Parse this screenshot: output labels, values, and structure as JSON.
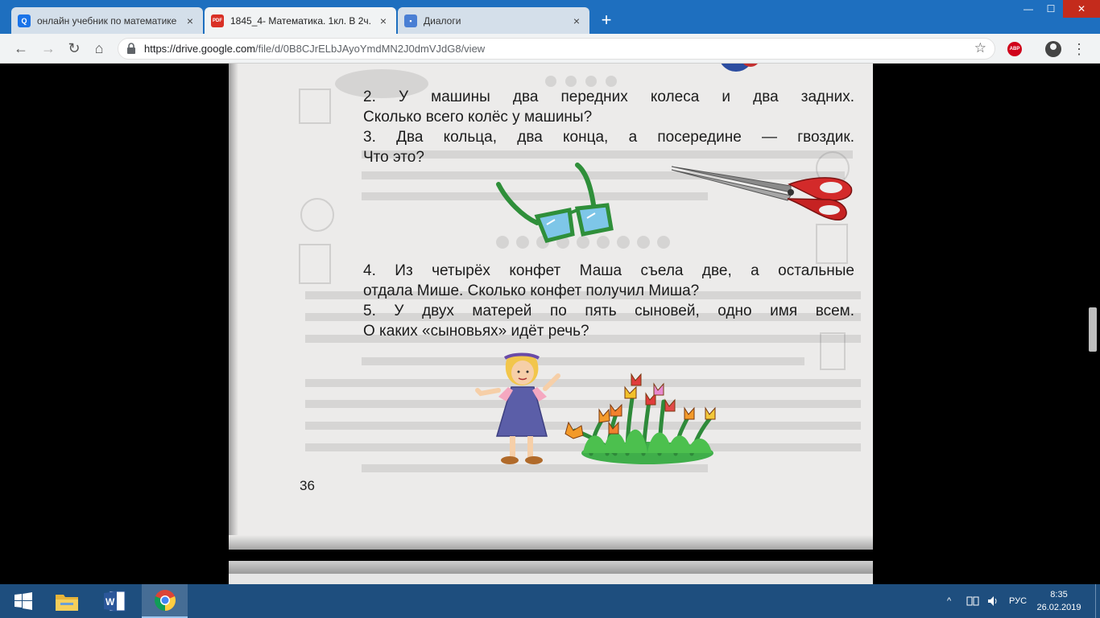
{
  "browser": {
    "tabs": [
      {
        "title": "онлайн учебник по математике",
        "icon": "search-icon",
        "active": false
      },
      {
        "title": "1845_4- Математика. 1кл. В 2ч.",
        "icon": "pdf-icon",
        "icon_text": "PDF",
        "active": true
      },
      {
        "title": "Диалоги",
        "icon": "chat-icon",
        "active": false
      }
    ],
    "close_glyph": "×",
    "new_tab_glyph": "+",
    "window_buttons": {
      "minimize": "—",
      "maximize": "☐",
      "close": "✕"
    },
    "nav": {
      "back": "←",
      "forward": "→",
      "reload": "↻",
      "home": "⌂"
    },
    "url_host": "https://drive.google.com",
    "url_path": "/file/d/0B8CJrELbJAyoYmdMN2J0dmVJdG8/view",
    "extension_label": "ABP",
    "star": "☆",
    "menu": "⋮"
  },
  "document": {
    "tasks": [
      {
        "line1": "2. У машины два передних колеса и два задних.",
        "line2": "Сколько всего колёс у машины?"
      },
      {
        "line1": "3. Два кольца, два конца, а посередине — гвоздик.",
        "line2": "Что это?"
      },
      {
        "line1": "4. Из четырёх конфет Маша съела две, а остальные",
        "line2": "отдала Мише. Сколько конфет получил Миша?"
      },
      {
        "line1": "5. У двух матерей по пять сыновей, одно имя всем.",
        "line2": "О каких «сыновьях» идёт речь?"
      }
    ],
    "page_number": "36"
  },
  "taskbar": {
    "language": "РУС",
    "time": "8:35",
    "date": "26.02.2019",
    "colors": {
      "taskbar": "#1e4e7e",
      "titlebar": "#1e6fbf"
    }
  }
}
